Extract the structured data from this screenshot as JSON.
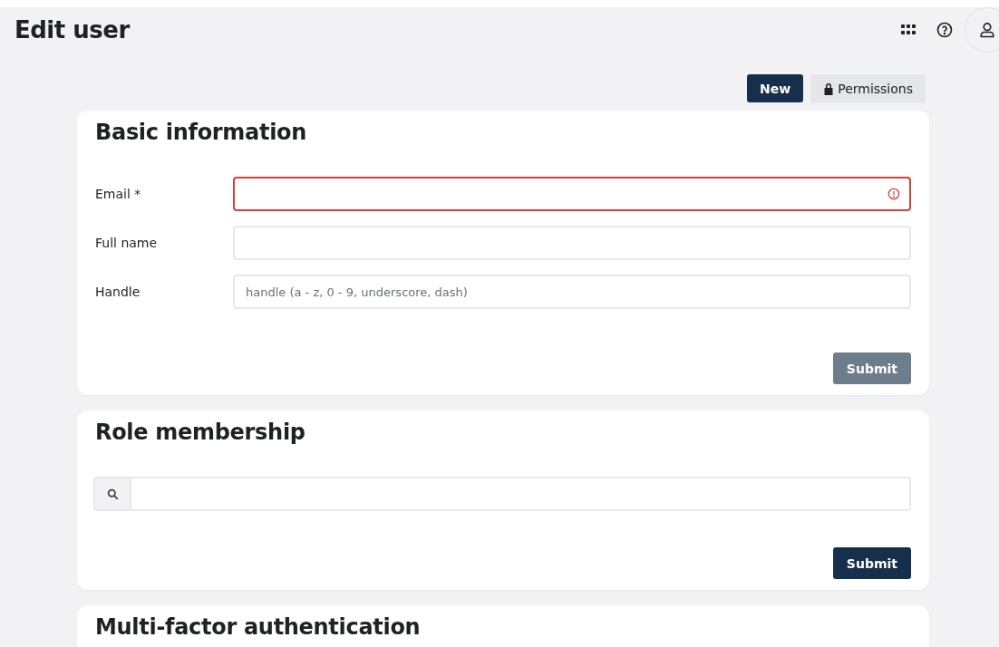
{
  "header": {
    "title": "Edit user"
  },
  "actions": [
    {
      "label": "New",
      "kind": "primary"
    },
    {
      "label": "Permissions",
      "kind": "secondary"
    }
  ],
  "sections": [
    {
      "title": "Basic information",
      "kind": "form",
      "fields": [
        {
          "label": "Email *",
          "invalid": true
        },
        {
          "label": "Full name",
          "invalid": false
        },
        {
          "label": "Handle",
          "placeholder": "handle (a - z, 0 - 9, underscore, dash)",
          "invalid": false
        }
      ],
      "submit": {
        "label": "Submit",
        "disabled": true
      }
    },
    {
      "title": "Role membership",
      "kind": "search",
      "submit": {
        "label": "Submit",
        "disabled": false
      }
    },
    {
      "title": "Multi-factor authentication",
      "kind": "stub"
    }
  ]
}
